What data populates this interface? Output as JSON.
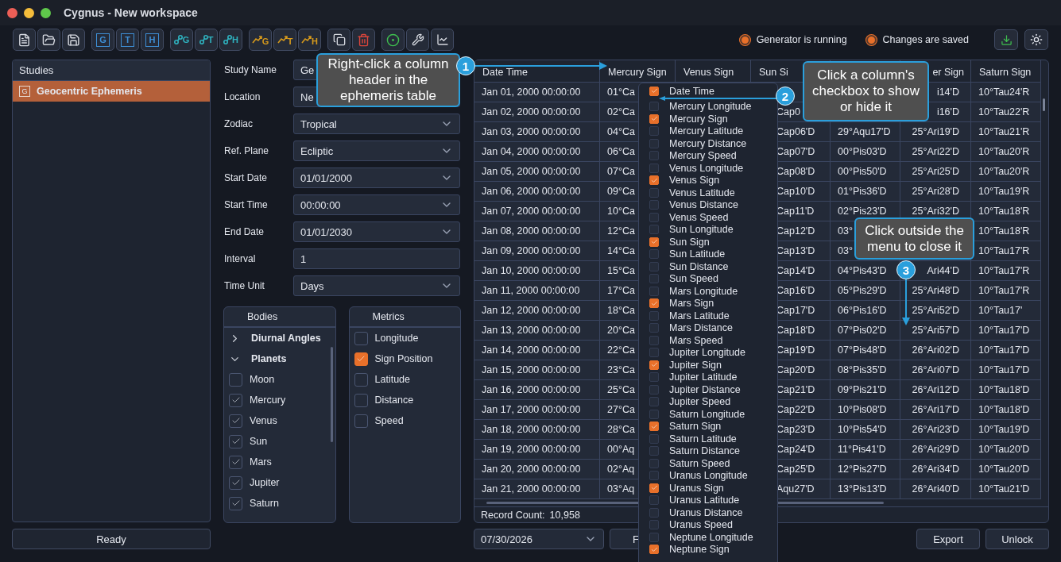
{
  "window": {
    "title": "Cygnus - New workspace"
  },
  "toolbar": [
    {
      "kind": "new-file"
    },
    {
      "kind": "open"
    },
    {
      "kind": "save"
    },
    {
      "kind": "box",
      "letter": "G"
    },
    {
      "kind": "box",
      "letter": "T"
    },
    {
      "kind": "box",
      "letter": "H"
    },
    {
      "kind": "node",
      "letter": "G"
    },
    {
      "kind": "node",
      "letter": "T"
    },
    {
      "kind": "node",
      "letter": "H"
    },
    {
      "kind": "trend",
      "letter": "G"
    },
    {
      "kind": "trend",
      "letter": "T"
    },
    {
      "kind": "trend",
      "letter": "H"
    },
    {
      "kind": "copy"
    },
    {
      "kind": "delete"
    },
    {
      "kind": "target"
    },
    {
      "kind": "wrench"
    },
    {
      "kind": "chart"
    }
  ],
  "status": [
    {
      "label": "Generator is running"
    },
    {
      "label": "Changes are saved"
    }
  ],
  "toolbar_right": [
    {
      "kind": "download"
    },
    {
      "kind": "theme"
    }
  ],
  "studies": {
    "title": "Studies",
    "items": [
      {
        "badge": "G",
        "label": "Geocentric Ephemeris",
        "selected": true
      }
    ],
    "status": "Ready"
  },
  "form": [
    {
      "label": "Study Name",
      "value": "Ge",
      "kind": "text"
    },
    {
      "label": "Location",
      "value": "Ne",
      "kind": "text"
    },
    {
      "label": "Zodiac",
      "value": "Tropical",
      "kind": "select"
    },
    {
      "label": "Ref. Plane",
      "value": "Ecliptic",
      "kind": "select"
    },
    {
      "label": "Start Date",
      "value": "01/01/2000",
      "kind": "select"
    },
    {
      "label": "Start Time",
      "value": "00:00:00",
      "kind": "select"
    },
    {
      "label": "End Date",
      "value": "01/01/2030",
      "kind": "select"
    },
    {
      "label": "Interval",
      "value": "1",
      "kind": "text"
    },
    {
      "label": "Time Unit",
      "value": "Days",
      "kind": "select"
    }
  ],
  "bodies": {
    "title": "Bodies",
    "groups": [
      {
        "label": "Diurnal Angles",
        "expanded": false
      },
      {
        "label": "Planets",
        "expanded": true,
        "children": [
          {
            "label": "Moon",
            "checked": false
          },
          {
            "label": "Mercury",
            "checked": true
          },
          {
            "label": "Venus",
            "checked": true
          },
          {
            "label": "Sun",
            "checked": true
          },
          {
            "label": "Mars",
            "checked": true
          },
          {
            "label": "Jupiter",
            "checked": true
          },
          {
            "label": "Saturn",
            "checked": true
          }
        ]
      }
    ]
  },
  "metrics": {
    "title": "Metrics",
    "items": [
      {
        "label": "Longitude",
        "checked": false
      },
      {
        "label": "Sign Position",
        "checked": true
      },
      {
        "label": "Latitude",
        "checked": false
      },
      {
        "label": "Distance",
        "checked": false
      },
      {
        "label": "Speed",
        "checked": false
      }
    ]
  },
  "table": {
    "columns": {
      "date_time": "Date Time",
      "mercury_sign": "Mercury Sign",
      "venus_sign": "Venus Sign",
      "sun_sign": "Sun Si",
      "jupiter_sign": "er Sign",
      "saturn_sign": "Saturn Sign"
    },
    "rows": [
      {
        "date_time": "Jan 01, 2000 00:00:00",
        "mercury_sign": "01°Ca",
        "jupiter_sign": "i14'D",
        "saturn_sign": "10°Tau24'R"
      },
      {
        "date_time": "Jan 02, 2000 00:00:00",
        "mercury_sign": "02°Ca",
        "sun_sign": "Cap0",
        "jupiter_sign": "i16'D",
        "saturn_sign": "10°Tau22'R"
      },
      {
        "date_time": "Jan 03, 2000 00:00:00",
        "mercury_sign": "04°Ca",
        "sun_sign": "Cap06'D",
        "column_5": "29°Aqu17'D",
        "jupiter_sign": "25°Ari19'D",
        "saturn_sign": "10°Tau21'R"
      },
      {
        "date_time": "Jan 04, 2000 00:00:00",
        "mercury_sign": "06°Ca",
        "sun_sign": "Cap07'D",
        "column_5": "00°Pis03'D",
        "jupiter_sign": "25°Ari22'D",
        "saturn_sign": "10°Tau20'R"
      },
      {
        "date_time": "Jan 05, 2000 00:00:00",
        "mercury_sign": "07°Ca",
        "sun_sign": "Cap08'D",
        "column_5": "00°Pis50'D",
        "jupiter_sign": "25°Ari25'D",
        "saturn_sign": "10°Tau20'R"
      },
      {
        "date_time": "Jan 06, 2000 00:00:00",
        "mercury_sign": "09°Ca",
        "sun_sign": "Cap10'D",
        "column_5": "01°Pis36'D",
        "jupiter_sign": "25°Ari28'D",
        "saturn_sign": "10°Tau19'R"
      },
      {
        "date_time": "Jan 07, 2000 00:00:00",
        "mercury_sign": "10°Ca",
        "sun_sign": "Cap11'D",
        "column_5": "02°Pis23'D",
        "jupiter_sign": "25°Ari32'D",
        "saturn_sign": "10°Tau18'R"
      },
      {
        "date_time": "Jan 08, 2000 00:00:00",
        "mercury_sign": "12°Ca",
        "sun_sign": "Cap12'D",
        "column_5": "03°",
        "saturn_sign": "10°Tau18'R"
      },
      {
        "date_time": "Jan 09, 2000 00:00:00",
        "mercury_sign": "14°Ca",
        "sun_sign": "Cap13'D",
        "column_5": "03°",
        "saturn_sign": "10°Tau17'R"
      },
      {
        "date_time": "Jan 10, 2000 00:00:00",
        "mercury_sign": "15°Ca",
        "sun_sign": "Cap14'D",
        "column_5": "04°Pis43'D",
        "jupiter_sign": "Ari44'D",
        "saturn_sign": "10°Tau17'R"
      },
      {
        "date_time": "Jan 11, 2000 00:00:00",
        "mercury_sign": "17°Ca",
        "sun_sign": "Cap16'D",
        "column_5": "05°Pis29'D",
        "jupiter_sign": "25°Ari48'D",
        "saturn_sign": "10°Tau17'R"
      },
      {
        "date_time": "Jan 12, 2000 00:00:00",
        "mercury_sign": "18°Ca",
        "sun_sign": "Cap17'D",
        "column_5": "06°Pis16'D",
        "jupiter_sign": "25°Ari52'D",
        "saturn_sign": "10°Tau17'"
      },
      {
        "date_time": "Jan 13, 2000 00:00:00",
        "mercury_sign": "20°Ca",
        "sun_sign": "Cap18'D",
        "column_5": "07°Pis02'D",
        "jupiter_sign": "25°Ari57'D",
        "saturn_sign": "10°Tau17'D"
      },
      {
        "date_time": "Jan 14, 2000 00:00:00",
        "mercury_sign": "22°Ca",
        "sun_sign": "Cap19'D",
        "column_5": "07°Pis48'D",
        "jupiter_sign": "26°Ari02'D",
        "saturn_sign": "10°Tau17'D"
      },
      {
        "date_time": "Jan 15, 2000 00:00:00",
        "mercury_sign": "23°Ca",
        "sun_sign": "Cap20'D",
        "column_5": "08°Pis35'D",
        "jupiter_sign": "26°Ari07'D",
        "saturn_sign": "10°Tau17'D"
      },
      {
        "date_time": "Jan 16, 2000 00:00:00",
        "mercury_sign": "25°Ca",
        "sun_sign": "Cap21'D",
        "column_5": "09°Pis21'D",
        "jupiter_sign": "26°Ari12'D",
        "saturn_sign": "10°Tau18'D"
      },
      {
        "date_time": "Jan 17, 2000 00:00:00",
        "mercury_sign": "27°Ca",
        "sun_sign": "Cap22'D",
        "column_5": "10°Pis08'D",
        "jupiter_sign": "26°Ari17'D",
        "saturn_sign": "10°Tau18'D"
      },
      {
        "date_time": "Jan 18, 2000 00:00:00",
        "mercury_sign": "28°Ca",
        "sun_sign": "Cap23'D",
        "column_5": "10°Pis54'D",
        "jupiter_sign": "26°Ari23'D",
        "saturn_sign": "10°Tau19'D"
      },
      {
        "date_time": "Jan 19, 2000 00:00:00",
        "mercury_sign": "00°Aq",
        "sun_sign": "Cap24'D",
        "column_5": "11°Pis41'D",
        "jupiter_sign": "26°Ari29'D",
        "saturn_sign": "10°Tau20'D"
      },
      {
        "date_time": "Jan 20, 2000 00:00:00",
        "mercury_sign": "02°Aq",
        "sun_sign": "Cap25'D",
        "column_5": "12°Pis27'D",
        "jupiter_sign": "26°Ari34'D",
        "saturn_sign": "10°Tau20'D"
      },
      {
        "date_time": "Jan 21, 2000 00:00:00",
        "mercury_sign": "03°Aq",
        "sun_sign": "Aqu27'D",
        "column_5": "13°Pis13'D",
        "jupiter_sign": "26°Ari40'D",
        "saturn_sign": "10°Tau21'D"
      }
    ],
    "record_count_label": "Record Count:",
    "record_count": "10,958"
  },
  "bottom": {
    "date": "07/30/2026",
    "button": "F",
    "export": "Export",
    "unlock": "Unlock"
  },
  "column_menu": {
    "items": [
      {
        "label": "Date Time",
        "checked": true
      },
      {
        "label": "Mercury Longitude",
        "checked": false
      },
      {
        "label": "Mercury Sign",
        "checked": true
      },
      {
        "label": "Mercury Latitude",
        "checked": false
      },
      {
        "label": "Mercury Distance",
        "checked": false
      },
      {
        "label": "Mercury Speed",
        "checked": false
      },
      {
        "label": "Venus Longitude",
        "checked": false
      },
      {
        "label": "Venus Sign",
        "checked": true
      },
      {
        "label": "Venus Latitude",
        "checked": false
      },
      {
        "label": "Venus Distance",
        "checked": false
      },
      {
        "label": "Venus Speed",
        "checked": false
      },
      {
        "label": "Sun Longitude",
        "checked": false
      },
      {
        "label": "Sun Sign",
        "checked": true
      },
      {
        "label": "Sun Latitude",
        "checked": false
      },
      {
        "label": "Sun Distance",
        "checked": false
      },
      {
        "label": "Sun Speed",
        "checked": false
      },
      {
        "label": "Mars Longitude",
        "checked": false
      },
      {
        "label": "Mars Sign",
        "checked": true
      },
      {
        "label": "Mars Latitude",
        "checked": false
      },
      {
        "label": "Mars Distance",
        "checked": false
      },
      {
        "label": "Mars Speed",
        "checked": false
      },
      {
        "label": "Jupiter Longitude",
        "checked": false
      },
      {
        "label": "Jupiter Sign",
        "checked": true
      },
      {
        "label": "Jupiter Latitude",
        "checked": false
      },
      {
        "label": "Jupiter Distance",
        "checked": false
      },
      {
        "label": "Jupiter Speed",
        "checked": false
      },
      {
        "label": "Saturn Longitude",
        "checked": false
      },
      {
        "label": "Saturn Sign",
        "checked": true
      },
      {
        "label": "Saturn Latitude",
        "checked": false
      },
      {
        "label": "Saturn Distance",
        "checked": false
      },
      {
        "label": "Saturn Speed",
        "checked": false
      },
      {
        "label": "Uranus Longitude",
        "checked": false
      },
      {
        "label": "Uranus Sign",
        "checked": true
      },
      {
        "label": "Uranus Latitude",
        "checked": false
      },
      {
        "label": "Uranus Distance",
        "checked": false
      },
      {
        "label": "Uranus Speed",
        "checked": false
      },
      {
        "label": "Neptune Longitude",
        "checked": false
      },
      {
        "label": "Neptune Sign",
        "checked": true
      }
    ]
  },
  "callouts": [
    {
      "number": "1",
      "text": "Right-click a column header in the ephemeris table"
    },
    {
      "number": "2",
      "text": "Click a column's checkbox to show or hide it"
    },
    {
      "number": "3",
      "text": "Click outside the menu to close it"
    }
  ]
}
